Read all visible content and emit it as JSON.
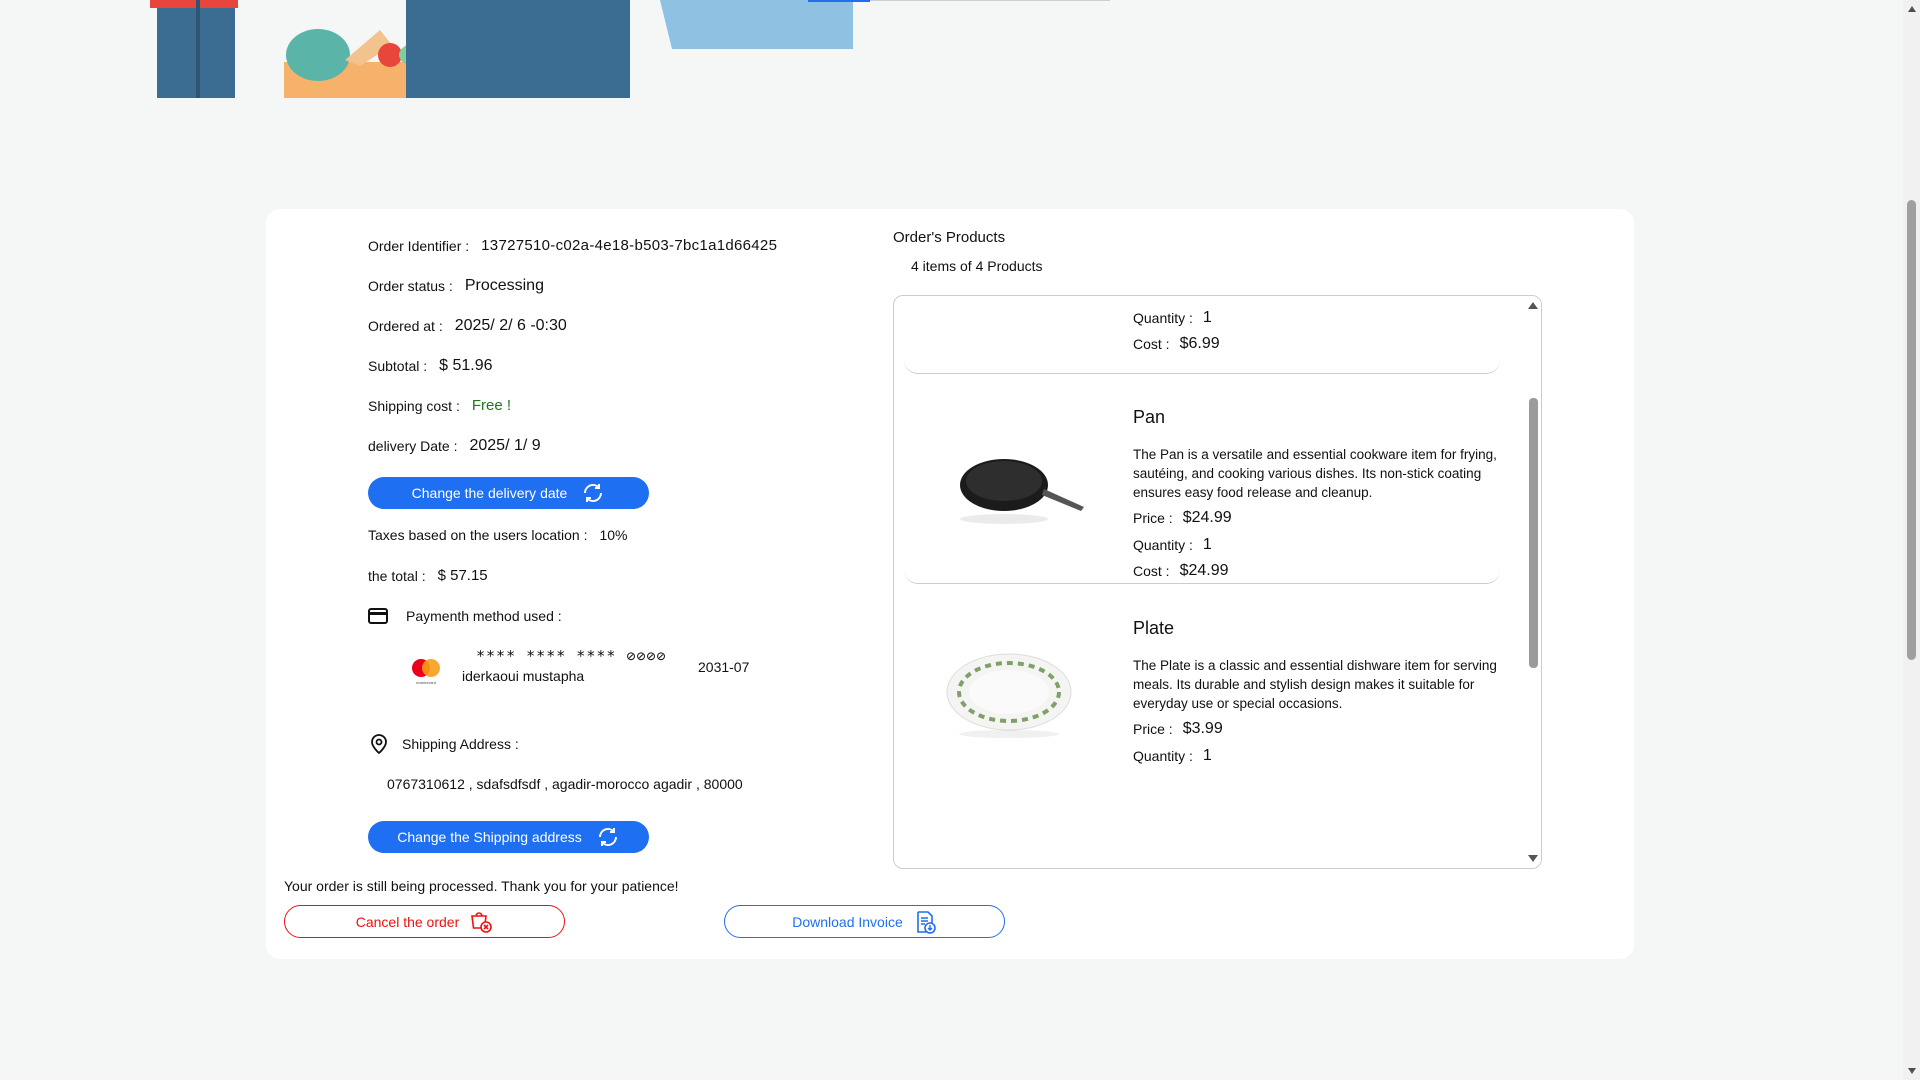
{
  "order": {
    "identifier_label": "Order Identifier :",
    "identifier": "13727510-c02a-4e18-b503-7bc1a1d66425",
    "status_label": "Order status :",
    "status": "Processing",
    "ordered_at_label": "Ordered at :",
    "ordered_at": "2025/ 2/ 6 -0:30",
    "subtotal_label": "Subtotal :",
    "subtotal": "$ 51.96",
    "shipping_label": "Shipping cost :",
    "shipping": "Free !",
    "delivery_label": "delivery Date :",
    "delivery": "2025/ 1/ 9",
    "change_delivery_button": "Change the delivery date",
    "taxes_label": "Taxes based on the users location :",
    "taxes": "10%",
    "total_label": "the total :",
    "total": "$ 57.15"
  },
  "payment": {
    "label": "Paymenth method used :",
    "card_number": "**** **** **** ⊘⊘⊘⊘",
    "holder": "iderkaoui mustapha",
    "expiry": "2031-07",
    "brand_text": "mastercard"
  },
  "shipping": {
    "label": "Shipping Address :",
    "address": "0767310612 , sdafsdfsdf , agadir-morocco agadir , 80000",
    "change_button": "Change the Shipping address"
  },
  "footer": {
    "status_message": "Your order is still being processed. Thank you for your patience!",
    "cancel_button": "Cancel the order",
    "invoice_button": "Download Invoice"
  },
  "products": {
    "title": "Order's Products",
    "count": "4 items of 4 Products",
    "price_label": "Price :",
    "quantity_label": "Quantity :",
    "cost_label": "Cost :",
    "items": [
      {
        "quantity": "1",
        "cost": "$6.99"
      },
      {
        "name": "Pan",
        "description": "The Pan is a versatile and essential cookware item for frying, sautéing, and cooking various dishes. Its non-stick coating ensures easy food release and cleanup.",
        "price": "$24.99",
        "quantity": "1",
        "cost": "$24.99"
      },
      {
        "name": "Plate",
        "description": "The Plate is a classic and essential dishware item for serving meals. Its durable and stylish design makes it suitable for everyday use or special occasions.",
        "price": "$3.99",
        "quantity": "1"
      }
    ]
  },
  "colors": {
    "accent": "#1e6ff1",
    "danger": "#e11111",
    "free": "#1a7a1a"
  }
}
